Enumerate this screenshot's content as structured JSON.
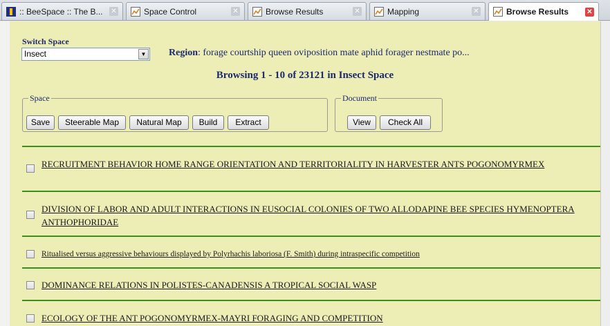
{
  "tabs": [
    {
      "title": ":: BeeSpace :: The B...",
      "icon": "beespace-logo-icon",
      "active": false
    },
    {
      "title": "Space Control",
      "icon": "chart-icon",
      "active": false
    },
    {
      "title": "Browse Results",
      "icon": "chart-icon",
      "active": false
    },
    {
      "title": "Mapping",
      "icon": "chart-icon",
      "active": false
    },
    {
      "title": "Browse Results",
      "icon": "chart-icon",
      "active": true
    }
  ],
  "switch_space": {
    "label": "Switch Space",
    "value": "Insect"
  },
  "region": {
    "label": "Region",
    "text": ": forage courtship queen oviposition mate aphid forager nestmate po..."
  },
  "browsing_text": "Browsing 1 - 10 of 23121 in Insect Space",
  "space_group": {
    "legend": "Space",
    "buttons": [
      "Save",
      "Steerable Map",
      "Natural Map",
      "Build",
      "Extract"
    ]
  },
  "document_group": {
    "legend": "Document",
    "buttons": [
      "View",
      "Check All"
    ]
  },
  "results": [
    {
      "title": "RECRUITMENT BEHAVIOR HOME RANGE ORIENTATION AND TERRITORIALITY IN HARVESTER ANTS POGONOMYRMEX",
      "checked": false
    },
    {
      "title": "DIVISION OF LABOR AND ADULT INTERACTIONS IN EUSOCIAL COLONIES OF TWO ALLODAPINE BEE SPECIES HYMENOPTERA ANTHOPHORIDAE",
      "checked": false
    },
    {
      "title": "Ritualised versus aggressive behaviours displayed by Polyrhachis laboriosa (F. Smith) during intraspecific competition",
      "checked": false
    },
    {
      "title": "DOMINANCE RELATIONS IN POLISTES-CANADENSIS A TROPICAL SOCIAL WASP",
      "checked": false
    },
    {
      "title": "ECOLOGY OF THE ANT POGONOMYRMEX-MAYRI FORAGING AND COMPETITION",
      "checked": false
    }
  ],
  "colors": {
    "page_background": "#ededb6",
    "divider": "#3a8f1f",
    "heading_text": "#1a2a6c",
    "active_tab_close": "#e04343"
  }
}
